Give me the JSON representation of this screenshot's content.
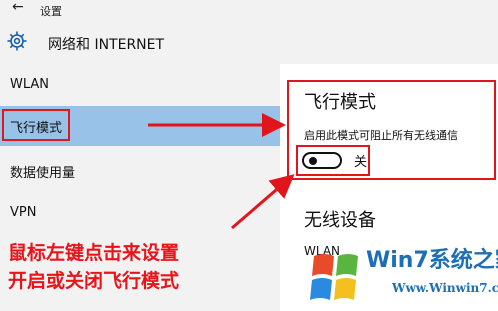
{
  "window": {
    "title": "设置",
    "back_glyph": "←"
  },
  "header": {
    "title": "网络和 INTERNET"
  },
  "sidebar": {
    "items": [
      {
        "label": "WLAN"
      },
      {
        "label": "飞行模式",
        "selected": true
      },
      {
        "label": "数据使用量"
      },
      {
        "label": "VPN"
      }
    ]
  },
  "airplane": {
    "title": "飞行模式",
    "description": "启用此模式可阻止所有无线通信",
    "toggle_state": "关",
    "toggle_on": false
  },
  "wireless": {
    "title": "无线设备",
    "items": [
      {
        "label": "WLAN"
      }
    ]
  },
  "annotation": {
    "line1": "鼠标左键点击来设置",
    "line2": "开启或关闭飞行模式",
    "color": "#e8141a"
  },
  "watermark": {
    "brand": "Win7系统之家",
    "url": "Www.Winwin7.com",
    "color": "#1c6fb4"
  },
  "colors": {
    "selected_bg": "#99c2e8",
    "chrome_bg": "#f2f2f2",
    "highlight_red": "#e1161c"
  },
  "icons": {
    "back": "back-arrow-icon",
    "settings": "gear-icon"
  }
}
